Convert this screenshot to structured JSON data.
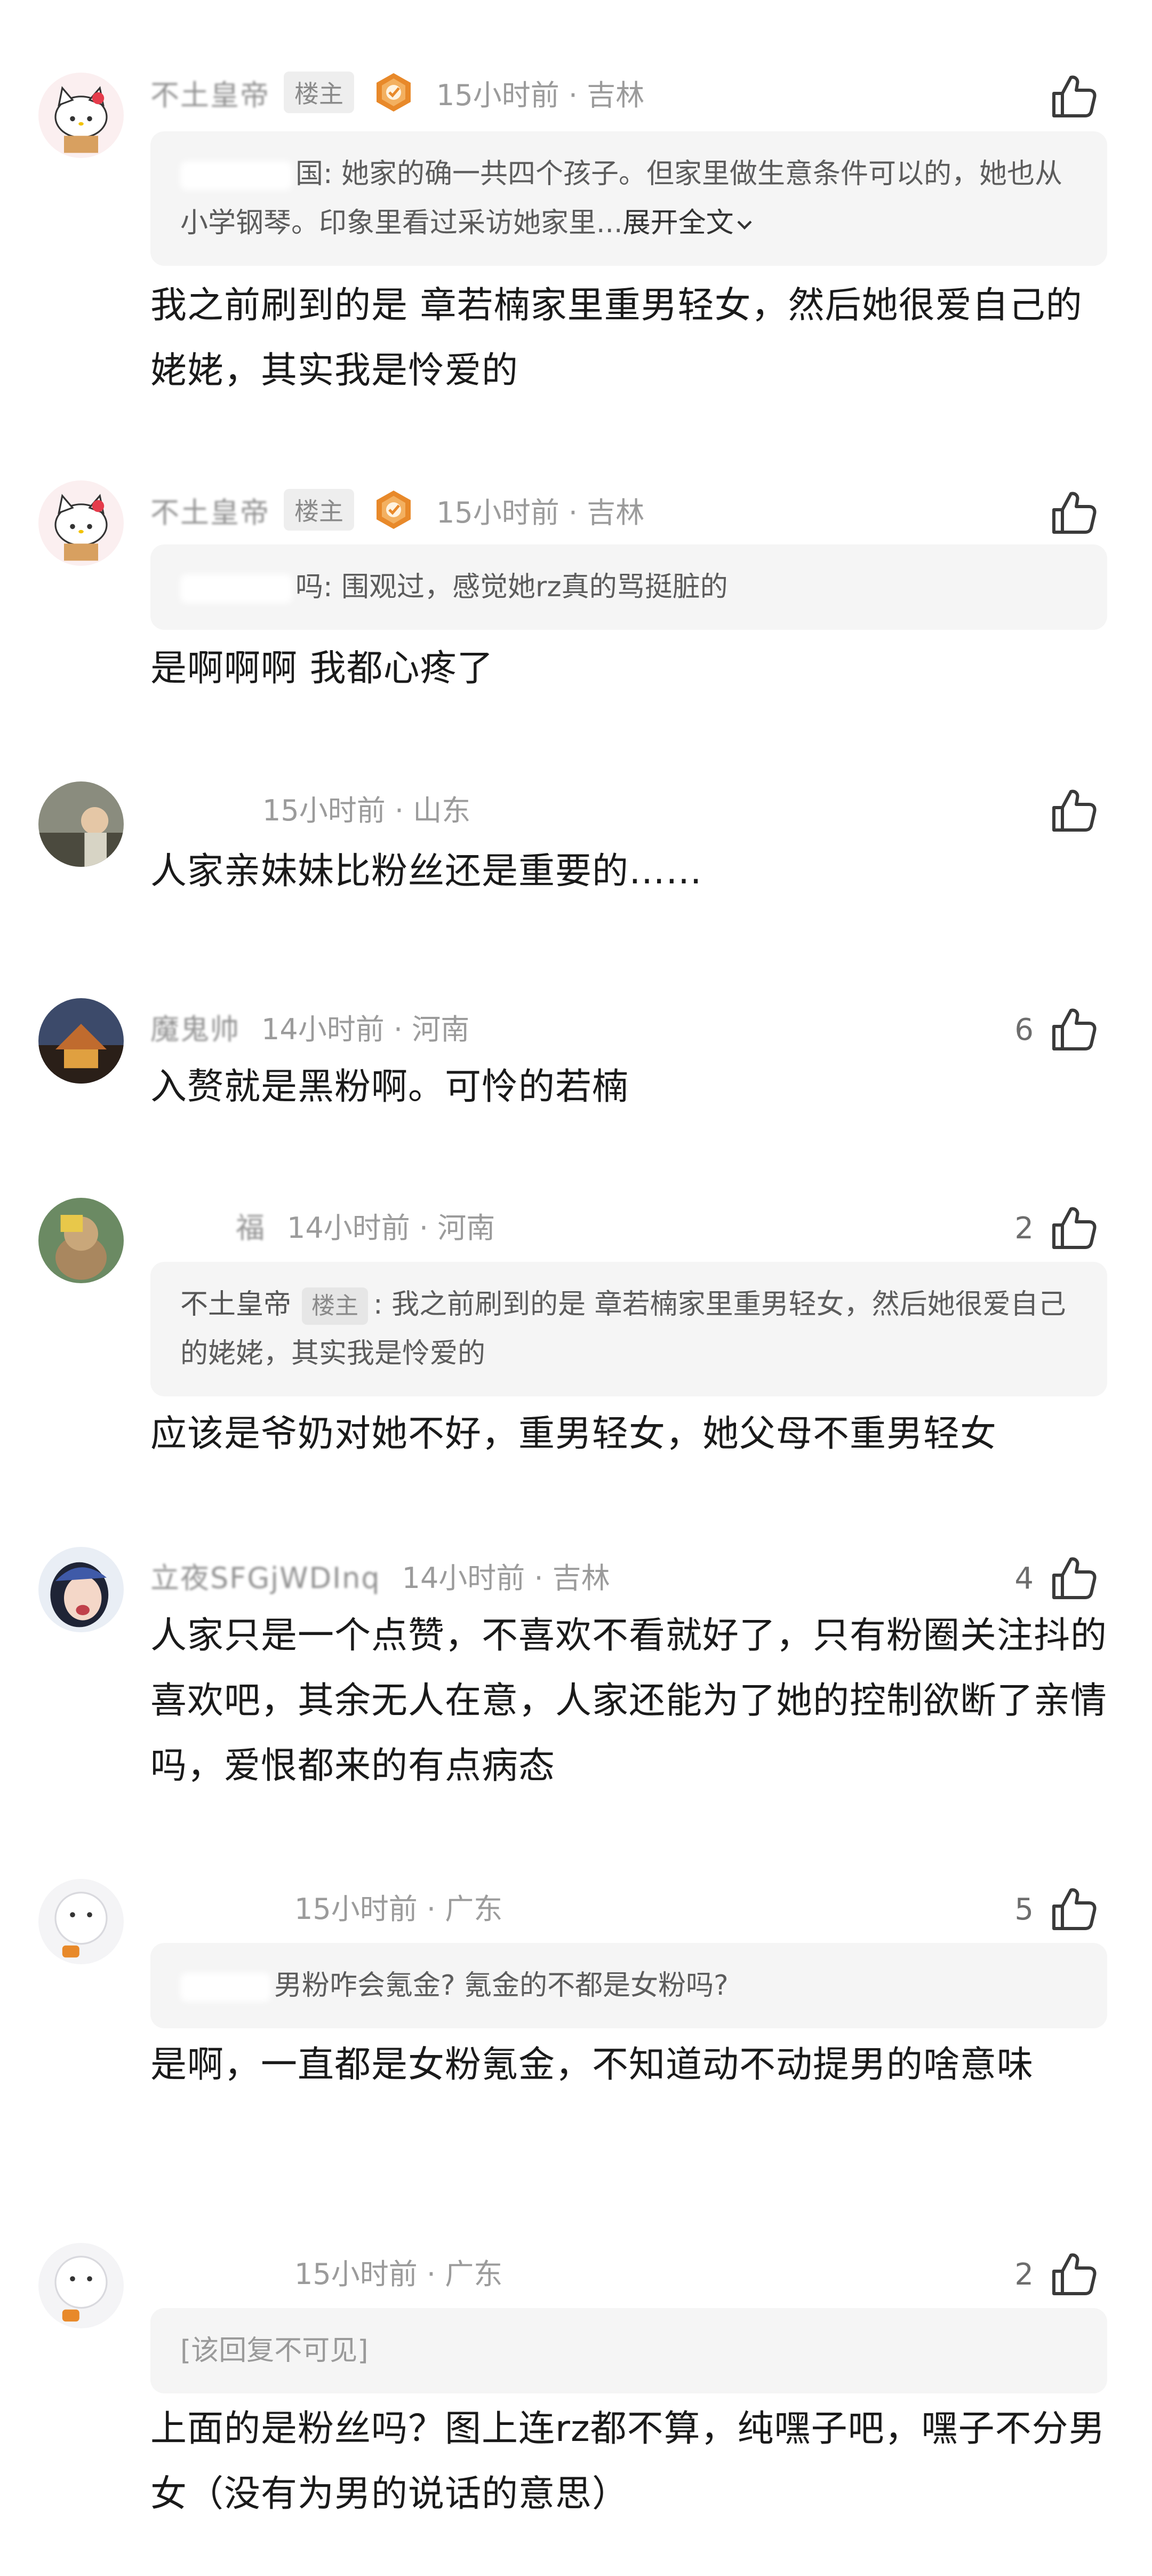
{
  "comments": [
    {
      "username": "不土皇帝",
      "op_badge": "楼主",
      "time_location": "15小时前 · 吉林",
      "like_count": "",
      "quote": {
        "text": "国: 她家的确一共四个孩子。但家里做生意条件可以的，她也从小学钢琴。印象里看过采访她家里...",
        "expand_label": "展开全文"
      },
      "text": "我之前刷到的是 章若楠家里重男轻女，然后她很爱自己的姥姥，其实我是怜爱的"
    },
    {
      "username": "不土皇帝",
      "op_badge": "楼主",
      "time_location": "15小时前 · 吉林",
      "like_count": "",
      "quote": {
        "text": "吗: 围观过，感觉她rz真的骂挺脏的"
      },
      "text": "是啊啊啊 我都心疼了"
    },
    {
      "username": "",
      "time_location": "15小时前 · 山东",
      "like_count": "",
      "text": "人家亲妹妹比粉丝还是重要的……"
    },
    {
      "username": "魔鬼帅",
      "time_location": "14小时前 · 河南",
      "like_count": "6",
      "text": "入赘就是黑粉啊。可怜的若楠"
    },
    {
      "username": "福",
      "time_location": "14小时前 · 河南",
      "like_count": "2",
      "quote": {
        "name": "不土皇帝",
        "badge": "楼主",
        "text": ": 我之前刷到的是 章若楠家里重男轻女，然后她很爱自己的姥姥，其实我是怜爱的"
      },
      "text": "应该是爷奶对她不好，重男轻女，她父母不重男轻女"
    },
    {
      "username": "立夜SFGjWDInq",
      "time_location": "14小时前 · 吉林",
      "like_count": "4",
      "text": "人家只是一个点赞，不喜欢不看就好了，只有粉圈关注抖的喜欢吧，其余无人在意，人家还能为了她的控制欲断了亲情吗，爱恨都来的有点病态"
    },
    {
      "username": "",
      "time_location": "15小时前 · 广东",
      "like_count": "5",
      "quote": {
        "text": "男粉咋会氪金? 氪金的不都是女粉吗?"
      },
      "text": "是啊，一直都是女粉氪金，不知道动不动提男的啥意味"
    },
    {
      "username": "",
      "time_location": "15小时前 · 广东",
      "like_count": "2",
      "quote": {
        "text": "[该回复不可见]"
      },
      "text": "上面的是粉丝吗？图上连rz都不算，纯嘿子吧，嘿子不分男女（没有为男的说话的意思）"
    }
  ],
  "icons": {
    "like": "thumbs-up-icon",
    "medal": "fan-medal-icon",
    "expand": "chevron-down-icon"
  },
  "colors": {
    "meta_gray": "#9b9b9b",
    "quote_bg": "#f5f5f5",
    "medal_orange": "#e8892a"
  }
}
